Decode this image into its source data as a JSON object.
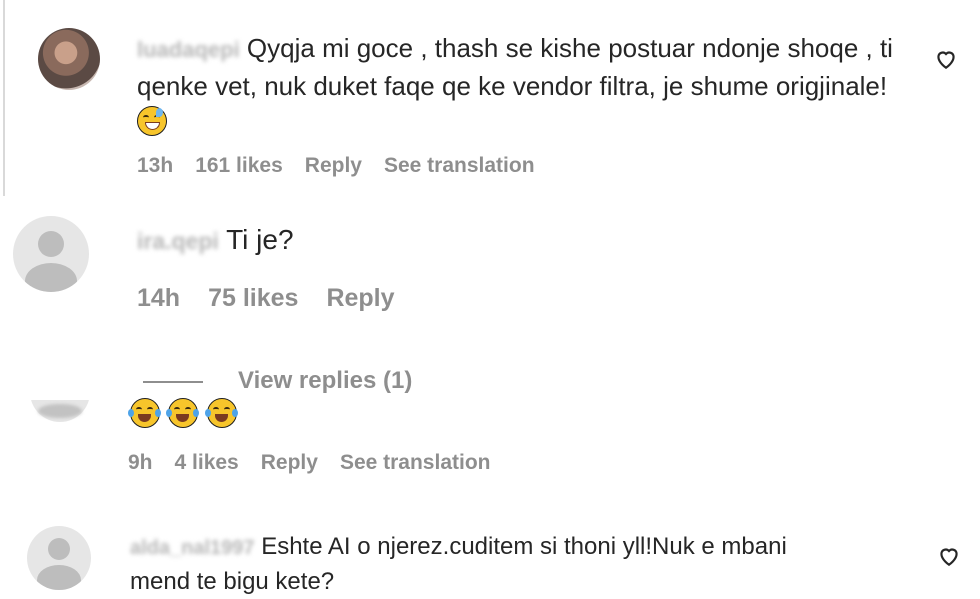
{
  "comments": [
    {
      "username": "luadaqepi",
      "text": "Qyqja mi goce , thash se kishe postuar ndonje shoqe , ti qenke vet, nuk duket faqe qe ke vendor filtra, je shume origjinale!",
      "emoji": "sweat-smile-emoji",
      "time": "13h",
      "likes": "161 likes",
      "reply": "Reply",
      "translate": "See translation"
    },
    {
      "username": "ira.qepi",
      "text": "Ti je?",
      "time": "14h",
      "likes": "75 likes",
      "reply": "Reply"
    },
    {
      "view_replies": "View replies (1)",
      "emojis": [
        "tears-of-joy-emoji",
        "tears-of-joy-emoji",
        "tears-of-joy-emoji"
      ],
      "time": "9h",
      "likes": "4 likes",
      "reply": "Reply",
      "translate": "See translation"
    },
    {
      "username": "alda_nal1997",
      "text": "Eshte AI o njerez.cuditem si thoni yll!Nuk e mbani mend te bigu kete?",
      "time": "",
      "likes": "",
      "reply": ""
    }
  ],
  "icons": {
    "like": "heart-outline-icon"
  },
  "colors": {
    "meta": "#8e8e8e",
    "text": "#262626"
  }
}
